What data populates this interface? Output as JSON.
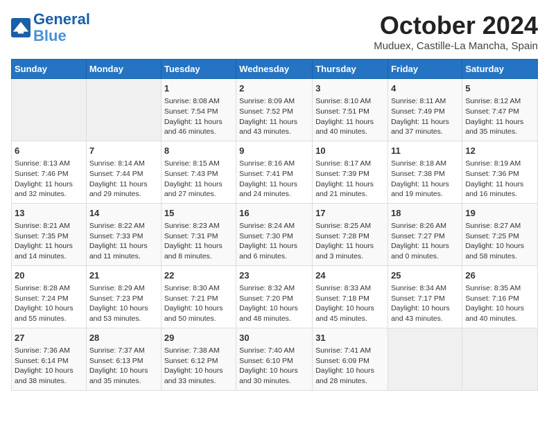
{
  "header": {
    "logo_line1": "General",
    "logo_line2": "Blue",
    "title": "October 2024",
    "location": "Muduex, Castille-La Mancha, Spain"
  },
  "weekdays": [
    "Sunday",
    "Monday",
    "Tuesday",
    "Wednesday",
    "Thursday",
    "Friday",
    "Saturday"
  ],
  "weeks": [
    [
      {
        "day": "",
        "info": ""
      },
      {
        "day": "",
        "info": ""
      },
      {
        "day": "1",
        "info": "Sunrise: 8:08 AM\nSunset: 7:54 PM\nDaylight: 11 hours and 46 minutes."
      },
      {
        "day": "2",
        "info": "Sunrise: 8:09 AM\nSunset: 7:52 PM\nDaylight: 11 hours and 43 minutes."
      },
      {
        "day": "3",
        "info": "Sunrise: 8:10 AM\nSunset: 7:51 PM\nDaylight: 11 hours and 40 minutes."
      },
      {
        "day": "4",
        "info": "Sunrise: 8:11 AM\nSunset: 7:49 PM\nDaylight: 11 hours and 37 minutes."
      },
      {
        "day": "5",
        "info": "Sunrise: 8:12 AM\nSunset: 7:47 PM\nDaylight: 11 hours and 35 minutes."
      }
    ],
    [
      {
        "day": "6",
        "info": "Sunrise: 8:13 AM\nSunset: 7:46 PM\nDaylight: 11 hours and 32 minutes."
      },
      {
        "day": "7",
        "info": "Sunrise: 8:14 AM\nSunset: 7:44 PM\nDaylight: 11 hours and 29 minutes."
      },
      {
        "day": "8",
        "info": "Sunrise: 8:15 AM\nSunset: 7:43 PM\nDaylight: 11 hours and 27 minutes."
      },
      {
        "day": "9",
        "info": "Sunrise: 8:16 AM\nSunset: 7:41 PM\nDaylight: 11 hours and 24 minutes."
      },
      {
        "day": "10",
        "info": "Sunrise: 8:17 AM\nSunset: 7:39 PM\nDaylight: 11 hours and 21 minutes."
      },
      {
        "day": "11",
        "info": "Sunrise: 8:18 AM\nSunset: 7:38 PM\nDaylight: 11 hours and 19 minutes."
      },
      {
        "day": "12",
        "info": "Sunrise: 8:19 AM\nSunset: 7:36 PM\nDaylight: 11 hours and 16 minutes."
      }
    ],
    [
      {
        "day": "13",
        "info": "Sunrise: 8:21 AM\nSunset: 7:35 PM\nDaylight: 11 hours and 14 minutes."
      },
      {
        "day": "14",
        "info": "Sunrise: 8:22 AM\nSunset: 7:33 PM\nDaylight: 11 hours and 11 minutes."
      },
      {
        "day": "15",
        "info": "Sunrise: 8:23 AM\nSunset: 7:31 PM\nDaylight: 11 hours and 8 minutes."
      },
      {
        "day": "16",
        "info": "Sunrise: 8:24 AM\nSunset: 7:30 PM\nDaylight: 11 hours and 6 minutes."
      },
      {
        "day": "17",
        "info": "Sunrise: 8:25 AM\nSunset: 7:28 PM\nDaylight: 11 hours and 3 minutes."
      },
      {
        "day": "18",
        "info": "Sunrise: 8:26 AM\nSunset: 7:27 PM\nDaylight: 11 hours and 0 minutes."
      },
      {
        "day": "19",
        "info": "Sunrise: 8:27 AM\nSunset: 7:25 PM\nDaylight: 10 hours and 58 minutes."
      }
    ],
    [
      {
        "day": "20",
        "info": "Sunrise: 8:28 AM\nSunset: 7:24 PM\nDaylight: 10 hours and 55 minutes."
      },
      {
        "day": "21",
        "info": "Sunrise: 8:29 AM\nSunset: 7:23 PM\nDaylight: 10 hours and 53 minutes."
      },
      {
        "day": "22",
        "info": "Sunrise: 8:30 AM\nSunset: 7:21 PM\nDaylight: 10 hours and 50 minutes."
      },
      {
        "day": "23",
        "info": "Sunrise: 8:32 AM\nSunset: 7:20 PM\nDaylight: 10 hours and 48 minutes."
      },
      {
        "day": "24",
        "info": "Sunrise: 8:33 AM\nSunset: 7:18 PM\nDaylight: 10 hours and 45 minutes."
      },
      {
        "day": "25",
        "info": "Sunrise: 8:34 AM\nSunset: 7:17 PM\nDaylight: 10 hours and 43 minutes."
      },
      {
        "day": "26",
        "info": "Sunrise: 8:35 AM\nSunset: 7:16 PM\nDaylight: 10 hours and 40 minutes."
      }
    ],
    [
      {
        "day": "27",
        "info": "Sunrise: 7:36 AM\nSunset: 6:14 PM\nDaylight: 10 hours and 38 minutes."
      },
      {
        "day": "28",
        "info": "Sunrise: 7:37 AM\nSunset: 6:13 PM\nDaylight: 10 hours and 35 minutes."
      },
      {
        "day": "29",
        "info": "Sunrise: 7:38 AM\nSunset: 6:12 PM\nDaylight: 10 hours and 33 minutes."
      },
      {
        "day": "30",
        "info": "Sunrise: 7:40 AM\nSunset: 6:10 PM\nDaylight: 10 hours and 30 minutes."
      },
      {
        "day": "31",
        "info": "Sunrise: 7:41 AM\nSunset: 6:09 PM\nDaylight: 10 hours and 28 minutes."
      },
      {
        "day": "",
        "info": ""
      },
      {
        "day": "",
        "info": ""
      }
    ]
  ]
}
